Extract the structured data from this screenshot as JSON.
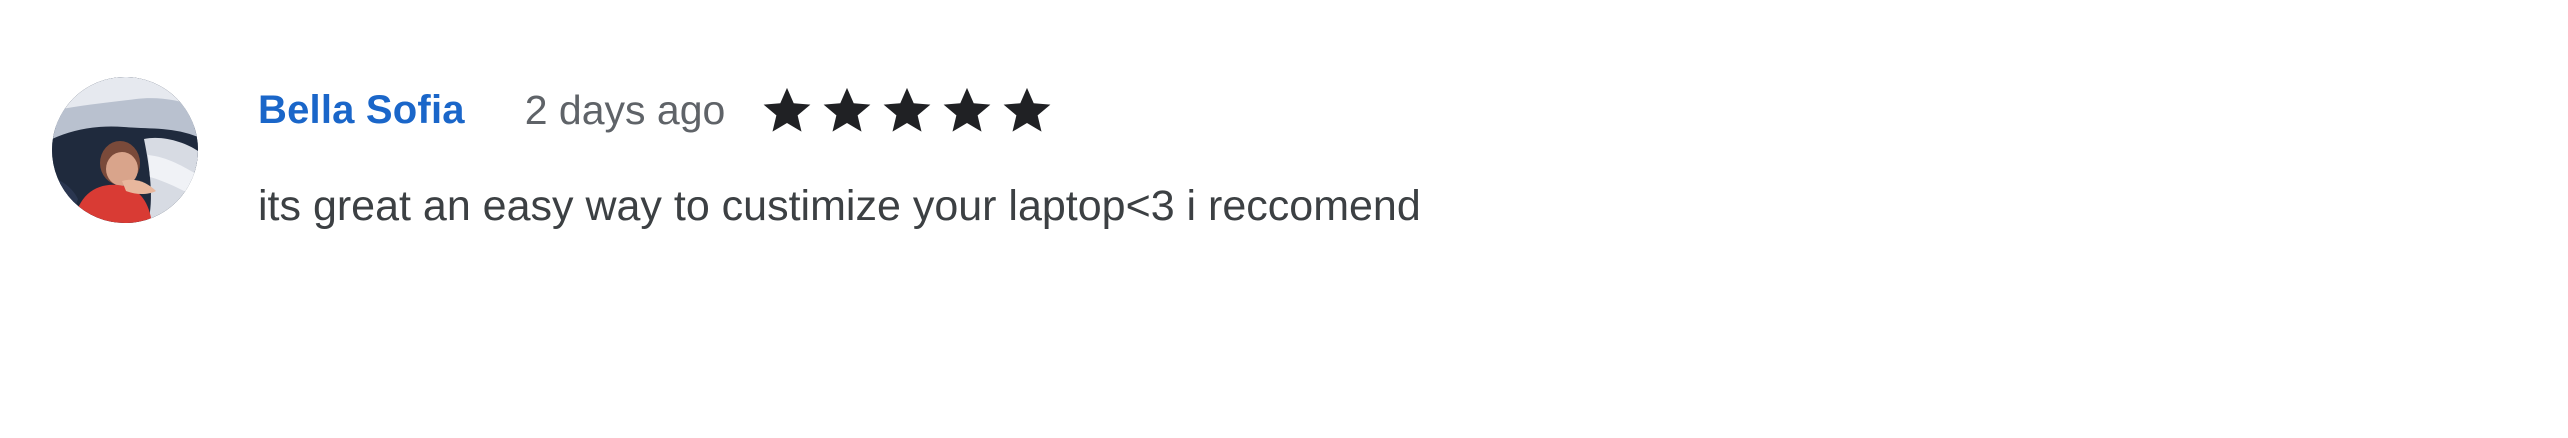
{
  "review": {
    "author": "Bella Sofia",
    "date": "2 days ago",
    "rating": 5,
    "rating_max": 5,
    "star_icon": "star-filled-icon",
    "text": "its great an easy way to custimize your laptop<3 i reccomend"
  },
  "colors": {
    "author": "#1a66c9",
    "date": "#5f6368",
    "stars": "#202124",
    "text": "#3c4043"
  }
}
